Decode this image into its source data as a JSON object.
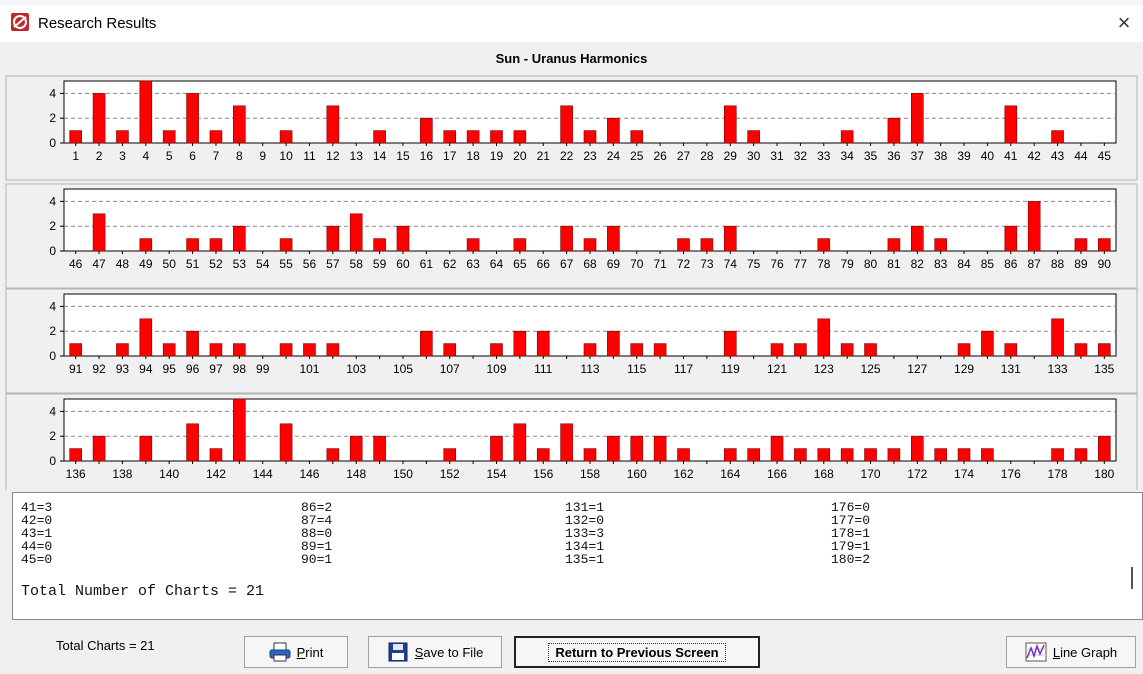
{
  "window": {
    "title": "Research Results",
    "close_glyph": "×",
    "icon": "app-icon"
  },
  "chart_data": {
    "type": "bar",
    "title": "Sun - Uranus Harmonics",
    "ylim": [
      0,
      5
    ],
    "yticks": [
      0,
      2,
      4
    ],
    "grid": true,
    "bar_color": "#ff0000",
    "panels": [
      {
        "x": [
          1,
          2,
          3,
          4,
          5,
          6,
          7,
          8,
          9,
          10,
          11,
          12,
          13,
          14,
          15,
          16,
          17,
          18,
          19,
          20,
          21,
          22,
          23,
          24,
          25,
          26,
          27,
          28,
          29,
          30,
          31,
          32,
          33,
          34,
          35,
          36,
          37,
          38,
          39,
          40,
          41,
          42,
          43,
          44,
          45
        ],
        "values": [
          1,
          4,
          1,
          5,
          1,
          4,
          1,
          3,
          0,
          1,
          0,
          3,
          0,
          1,
          0,
          2,
          1,
          1,
          1,
          1,
          0,
          3,
          1,
          2,
          1,
          0,
          0,
          0,
          3,
          1,
          0,
          0,
          0,
          1,
          0,
          2,
          4,
          0,
          0,
          0,
          3,
          0,
          1,
          0,
          0
        ],
        "labels": [
          "1",
          "2",
          "3",
          "4",
          "5",
          "6",
          "7",
          "8",
          "9",
          "10",
          "11",
          "12",
          "13",
          "14",
          "15",
          "16",
          "17",
          "18",
          "19",
          "20",
          "21",
          "22",
          "23",
          "24",
          "25",
          "26",
          "27",
          "28",
          "29",
          "30",
          "31",
          "32",
          "33",
          "34",
          "35",
          "36",
          "37",
          "38",
          "39",
          "40",
          "41",
          "42",
          "43",
          "44",
          "45"
        ]
      },
      {
        "x": [
          46,
          47,
          48,
          49,
          50,
          51,
          52,
          53,
          54,
          55,
          56,
          57,
          58,
          59,
          60,
          61,
          62,
          63,
          64,
          65,
          66,
          67,
          68,
          69,
          70,
          71,
          72,
          73,
          74,
          75,
          76,
          77,
          78,
          79,
          80,
          81,
          82,
          83,
          84,
          85,
          86,
          87,
          88,
          89,
          90
        ],
        "values": [
          0,
          3,
          0,
          1,
          0,
          1,
          1,
          2,
          0,
          1,
          0,
          2,
          3,
          1,
          2,
          0,
          0,
          1,
          0,
          1,
          0,
          2,
          1,
          2,
          0,
          0,
          1,
          1,
          2,
          0,
          0,
          0,
          1,
          0,
          0,
          1,
          2,
          1,
          0,
          0,
          2,
          4,
          0,
          1,
          1
        ],
        "labels": [
          "46",
          "47",
          "48",
          "49",
          "50",
          "51",
          "52",
          "53",
          "54",
          "55",
          "56",
          "57",
          "58",
          "59",
          "60",
          "61",
          "62",
          "63",
          "64",
          "65",
          "66",
          "67",
          "68",
          "69",
          "70",
          "71",
          "72",
          "73",
          "74",
          "75",
          "76",
          "77",
          "78",
          "79",
          "80",
          "81",
          "82",
          "83",
          "84",
          "85",
          "86",
          "87",
          "88",
          "89",
          "90"
        ]
      },
      {
        "x": [
          91,
          92,
          93,
          94,
          95,
          96,
          97,
          98,
          99,
          100,
          101,
          102,
          103,
          104,
          105,
          106,
          107,
          108,
          109,
          110,
          111,
          112,
          113,
          114,
          115,
          116,
          117,
          118,
          119,
          120,
          121,
          122,
          123,
          124,
          125,
          126,
          127,
          128,
          129,
          130,
          131,
          132,
          133,
          134,
          135
        ],
        "values": [
          1,
          0,
          1,
          3,
          1,
          2,
          1,
          1,
          0,
          1,
          1,
          1,
          0,
          0,
          0,
          2,
          1,
          0,
          1,
          2,
          2,
          0,
          1,
          2,
          1,
          1,
          0,
          0,
          2,
          0,
          1,
          1,
          3,
          1,
          1,
          0,
          0,
          0,
          1,
          2,
          1,
          0,
          3,
          1,
          1
        ],
        "labels": [
          "91",
          "92",
          "93",
          "94",
          "95",
          "96",
          "97",
          "98",
          "99",
          "",
          "101",
          "",
          "103",
          "",
          "105",
          "",
          "107",
          "",
          "109",
          "",
          "111",
          "",
          "113",
          "",
          "115",
          "",
          "117",
          "",
          "119",
          "",
          "121",
          "",
          "123",
          "",
          "125",
          "",
          "127",
          "",
          "129",
          "",
          "131",
          "",
          "133",
          "",
          "135"
        ]
      },
      {
        "x": [
          136,
          137,
          138,
          139,
          140,
          141,
          142,
          143,
          144,
          145,
          146,
          147,
          148,
          149,
          150,
          151,
          152,
          153,
          154,
          155,
          156,
          157,
          158,
          159,
          160,
          161,
          162,
          163,
          164,
          165,
          166,
          167,
          168,
          169,
          170,
          171,
          172,
          173,
          174,
          175,
          176,
          177,
          178,
          179,
          180
        ],
        "values": [
          1,
          2,
          0,
          2,
          0,
          3,
          1,
          5,
          0,
          3,
          0,
          1,
          2,
          2,
          0,
          0,
          1,
          0,
          2,
          3,
          1,
          3,
          1,
          2,
          2,
          2,
          1,
          0,
          1,
          1,
          2,
          1,
          1,
          1,
          1,
          1,
          2,
          1,
          1,
          1,
          0,
          0,
          1,
          1,
          2
        ],
        "labels": [
          "136",
          "",
          "138",
          "",
          "140",
          "",
          "142",
          "",
          "144",
          "",
          "146",
          "",
          "148",
          "",
          "150",
          "",
          "152",
          "",
          "154",
          "",
          "156",
          "",
          "158",
          "",
          "160",
          "",
          "162",
          "",
          "164",
          "",
          "166",
          "",
          "168",
          "",
          "170",
          "",
          "172",
          "",
          "174",
          "",
          "176",
          "",
          "178",
          "",
          "180"
        ]
      }
    ]
  },
  "results": {
    "columns": [
      [
        "41=3",
        "42=0",
        "43=1",
        "44=0",
        "45=0"
      ],
      [
        "86=2",
        "87=4",
        "88=0",
        "89=1",
        "90=1"
      ],
      [
        "131=1",
        "132=0",
        "133=3",
        "134=1",
        "135=1"
      ],
      [
        "176=0",
        "177=0",
        "178=1",
        "179=1",
        "180=2"
      ]
    ],
    "total_line": "Total Number of Charts = 21"
  },
  "footer": {
    "total_charts": "Total Charts = 21",
    "print": {
      "prefix": "",
      "accel": "P",
      "rest": "rint",
      "icon": "printer-icon"
    },
    "save": {
      "prefix": "",
      "accel": "S",
      "rest": "ave to File",
      "icon": "floppy-disk-icon"
    },
    "return_label": "Return to Previous Screen",
    "line_graph": {
      "prefix": "",
      "accel": "L",
      "rest": "ine Graph",
      "icon": "line-graph-icon"
    }
  }
}
